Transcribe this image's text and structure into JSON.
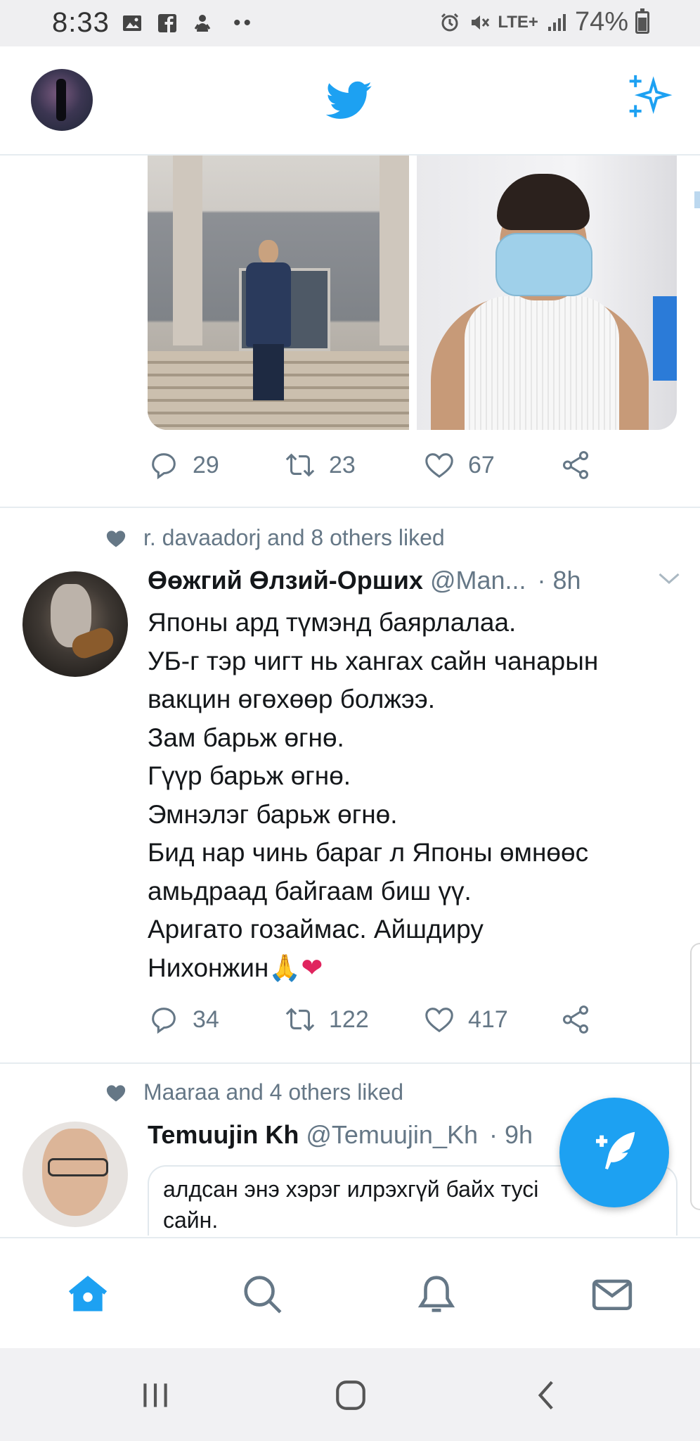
{
  "status_bar": {
    "time": "8:33",
    "network": "LTE+",
    "battery": "74%",
    "icons": [
      "image-icon",
      "facebook-icon",
      "notification-icon",
      "more-dots-icon",
      "alarm-icon",
      "mute-icon",
      "signal-icon",
      "battery-icon"
    ],
    "dots": "••"
  },
  "app_bar": {
    "logo": "twitter-bird-icon",
    "right_icon": "sparkle-icon"
  },
  "colors": {
    "accent": "#1da1f2",
    "text": "#14171a",
    "secondary": "#657786",
    "divider": "#e6ecf0"
  },
  "tweets": [
    {
      "has_media": true,
      "actions": {
        "replies": "29",
        "retweets": "23",
        "likes": "67"
      }
    },
    {
      "liked_by": "r. davaadorj and 8 others liked",
      "name": "Өөжгий Өлзий-Орших",
      "handle": "@Man...",
      "time": "· 8h",
      "text_lines": [
        "Японы ард түмэнд баярлалаа.",
        "УБ-г тэр чигт нь хангах сайн чанарын",
        "вакцин өгөхөөр болжээ.",
        "Зам барьж өгнө.",
        "Гүүр барьж өгнө.",
        "Эмнэлэг барьж өгнө.",
        "Бид нар чинь бараг л Японы өмнөөс",
        "амьдраад байгаам биш үү.",
        "Аригато гозаймас. Айшдиру",
        "Нихонжин"
      ],
      "emoji_pray": "🙏",
      "emoji_heart": "❤",
      "actions": {
        "replies": "34",
        "retweets": "122",
        "likes": "417"
      }
    },
    {
      "liked_by": "Maaraa and 4 others liked",
      "name": "Temuujin Kh",
      "handle": "@Temuujin_Kh",
      "time": "· 9h",
      "quote_lines": [
        "алдсан энэ хэрэг илрэхгүй байх тусі",
        "сайн."
      ]
    }
  ],
  "bottom_nav": [
    "home-icon",
    "search-icon",
    "notifications-icon",
    "messages-icon"
  ],
  "system_nav": [
    "recent-apps-icon",
    "home-button-icon",
    "back-icon"
  ]
}
